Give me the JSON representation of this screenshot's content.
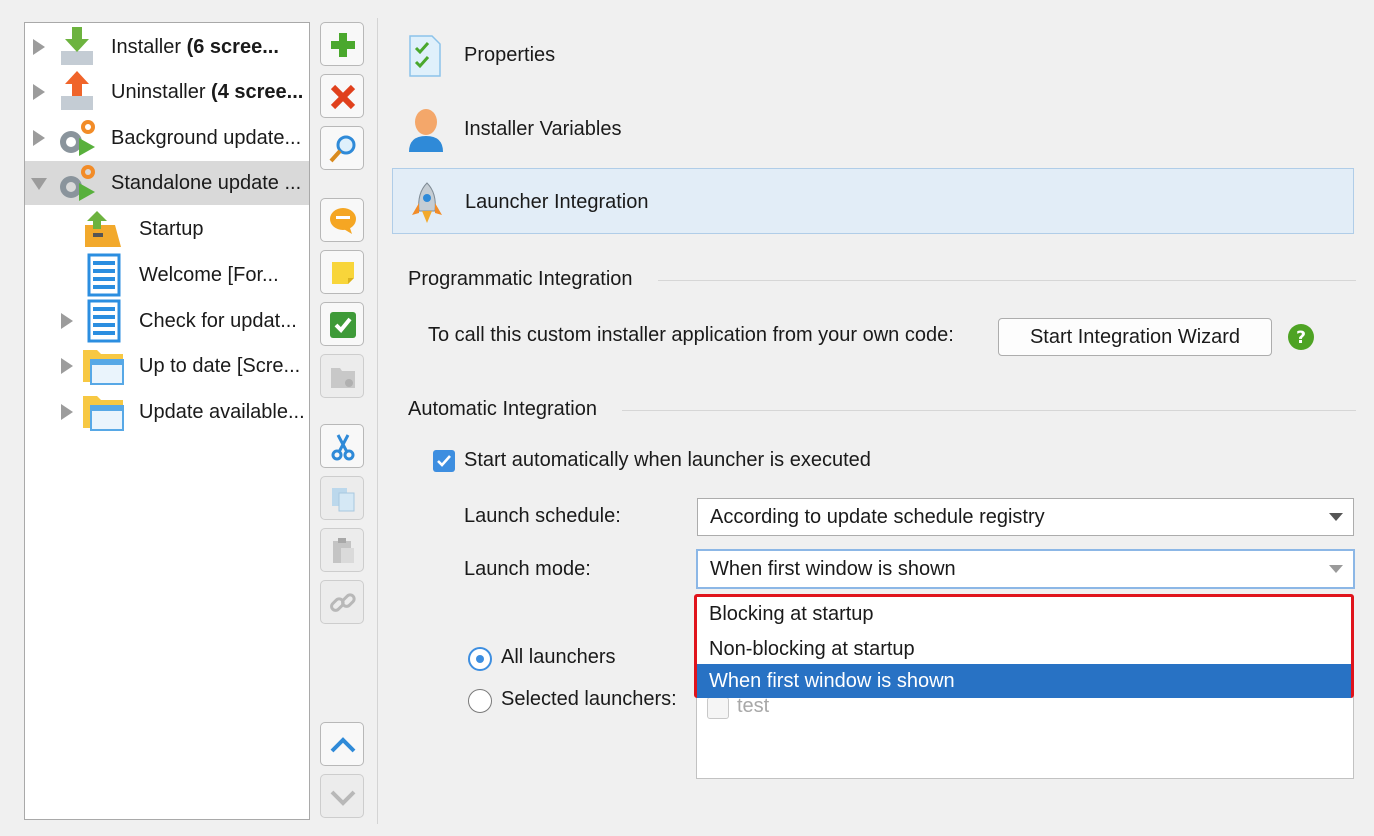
{
  "tree": {
    "items": [
      {
        "icon": "installer-icon",
        "label_plain": "Installer ",
        "label_bold": "(6 scree..."
      },
      {
        "icon": "uninstaller-icon",
        "label_plain": "Uninstaller ",
        "label_bold": "(4 scree..."
      },
      {
        "icon": "background-updater-icon",
        "label_plain": "Background update..."
      },
      {
        "icon": "standalone-updater-icon",
        "label_plain": "Standalone update ..."
      },
      {
        "icon": "startup-icon",
        "label_plain": "Startup"
      },
      {
        "icon": "screen-form-icon",
        "label_plain": "Welcome [For..."
      },
      {
        "icon": "screen-form-icon",
        "label_plain": "Check for updat..."
      },
      {
        "icon": "screen-window-icon",
        "label_plain": "Up to date [Scre..."
      },
      {
        "icon": "screen-window-icon",
        "label_plain": "Update available..."
      }
    ]
  },
  "toolbar": {
    "buttons": [
      "add-icon",
      "delete-icon",
      "search-icon",
      "comment-icon",
      "note-icon",
      "check-icon",
      "folder-icon",
      "cut-icon",
      "copy-icon",
      "paste-icon",
      "link-icon",
      "move-up-icon",
      "move-down-icon"
    ]
  },
  "sections": {
    "properties": "Properties",
    "installer_variables": "Installer Variables",
    "launcher_integration": "Launcher Integration"
  },
  "programmatic": {
    "title": "Programmatic Integration",
    "description": "To call this custom installer application from your own code:",
    "wizard_button": "Start Integration Wizard"
  },
  "automatic": {
    "title": "Automatic Integration",
    "start_auto_label": "Start automatically when launcher is executed",
    "start_auto_checked": true,
    "schedule_label": "Launch schedule:",
    "schedule_value": "According to update schedule registry",
    "mode_label": "Launch mode:",
    "mode_value": "When first window is shown",
    "mode_options": [
      "Blocking at startup",
      "Non-blocking at startup",
      "When first window is shown"
    ],
    "mode_selected_index": 2,
    "all_launchers_label": "All launchers",
    "selected_launchers_label": "Selected launchers:",
    "launcher_list": [
      "test"
    ]
  },
  "colors": {
    "selection_blue": "#2872c4",
    "highlight_red": "#e0141c",
    "checkbox_blue": "#3d8ee0",
    "help_green": "#4ea324"
  }
}
